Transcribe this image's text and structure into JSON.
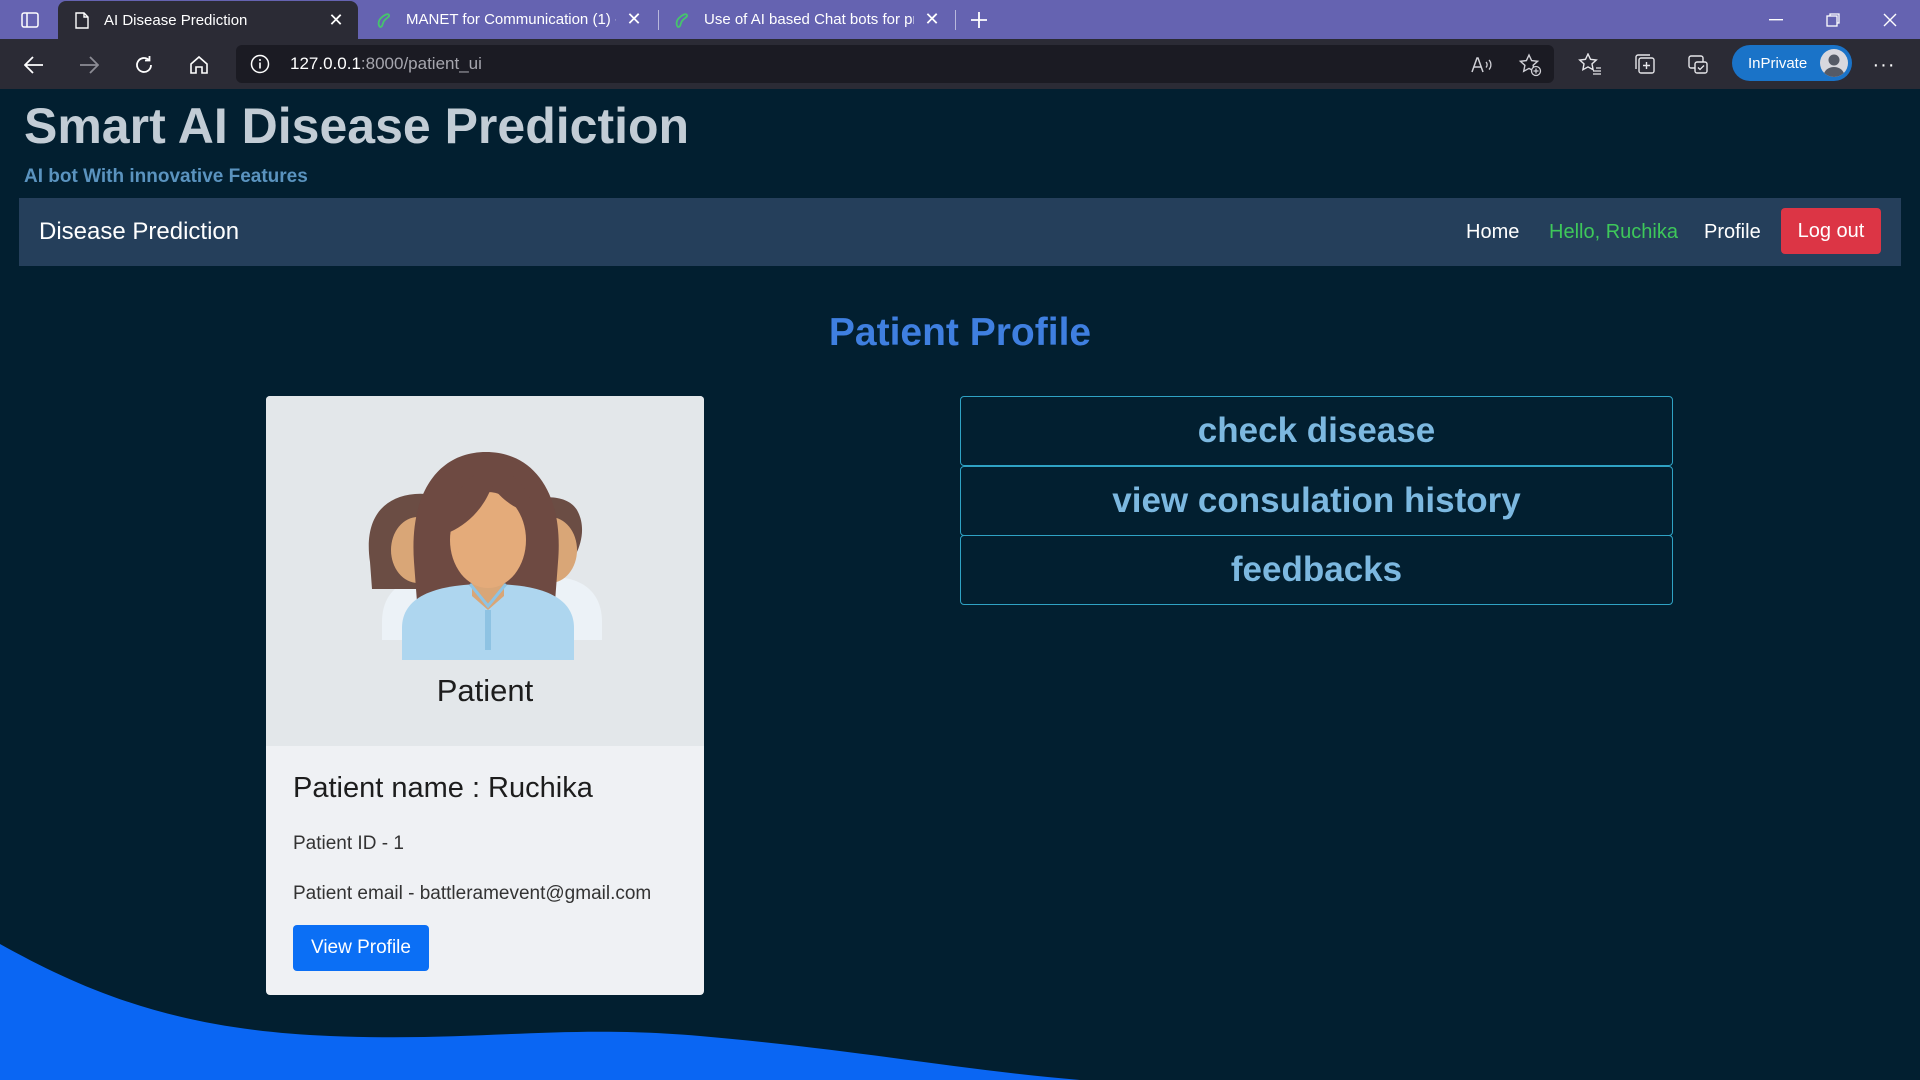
{
  "browser": {
    "tabs": [
      {
        "title": "AI Disease Prediction",
        "active": true,
        "icon": "page-icon"
      },
      {
        "title": "MANET for Communication (1) -",
        "active": false,
        "icon": "copilot-icon"
      },
      {
        "title": "Use of AI based Chat bots for pr",
        "active": false,
        "icon": "copilot-icon"
      }
    ],
    "url_host": "127.0.0.1",
    "url_path": ":8000/patient_ui",
    "inprivate_label": "InPrivate"
  },
  "site": {
    "title": "Smart AI Disease Prediction",
    "subtitle": "AI bot With innovative Features"
  },
  "navbar": {
    "brand": "Disease Prediction",
    "home": "Home",
    "hello": "Hello, Ruchika",
    "profile": "Profile",
    "logout": "Log out"
  },
  "main": {
    "heading": "Patient Profile",
    "card": {
      "caption": "Patient",
      "name_line": "Patient name : Ruchika",
      "id_line": "Patient ID - 1",
      "email_line": "Patient email - battleramevent@gmail.com",
      "view_button": "View Profile"
    },
    "actions": [
      "check disease",
      "view consulation history",
      "feedbacks"
    ]
  },
  "colors": {
    "page_bg": "#021f30",
    "navbar_bg": "#253f5b",
    "logout_bg": "#dc3545",
    "hello_text": "#3ec85a",
    "heading": "#3f7fe0",
    "primary_button": "#0b6ff5",
    "wave": "#0a66f3",
    "tabbar": "#6563b1"
  }
}
